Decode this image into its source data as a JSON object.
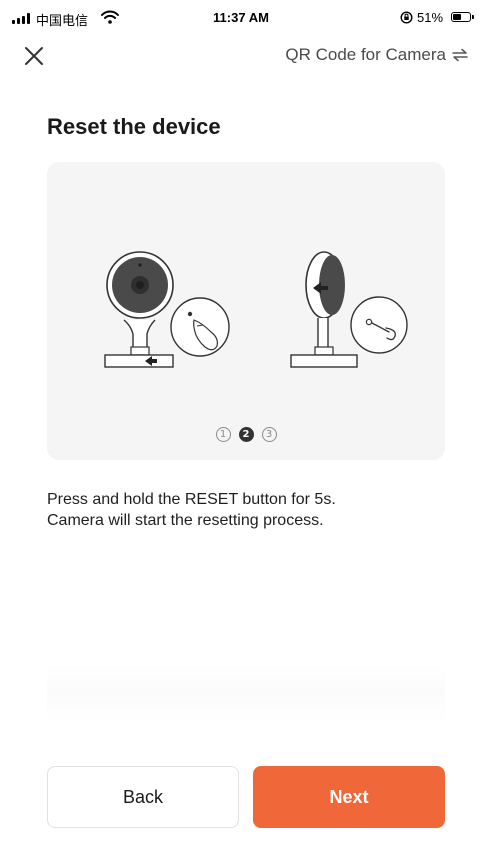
{
  "status_bar": {
    "carrier": "中国电信",
    "time": "11:37 AM",
    "battery_percent": "51%",
    "battery_level": 0.51,
    "signal_bars": 4,
    "icons": [
      "signal-icon",
      "wifi-icon",
      "orientation-lock-icon",
      "battery-icon"
    ]
  },
  "nav": {
    "close_icon": "close-icon",
    "mode_label": "QR Code for Camera",
    "mode_icon": "switch-arrows-icon"
  },
  "page": {
    "title": "Reset the device",
    "illustration": {
      "steps": [
        "1",
        "2",
        "3"
      ],
      "active_step": 2
    },
    "instruction_lines": [
      "Press and hold the RESET button for 5s.",
      "Camera will start the resetting process."
    ]
  },
  "buttons": {
    "back": "Back",
    "next": "Next"
  },
  "colors": {
    "accent": "#f0683a",
    "card_background": "#f5f5f5",
    "text_primary": "#1a1a1a",
    "text_secondary": "#4a4a4a"
  }
}
